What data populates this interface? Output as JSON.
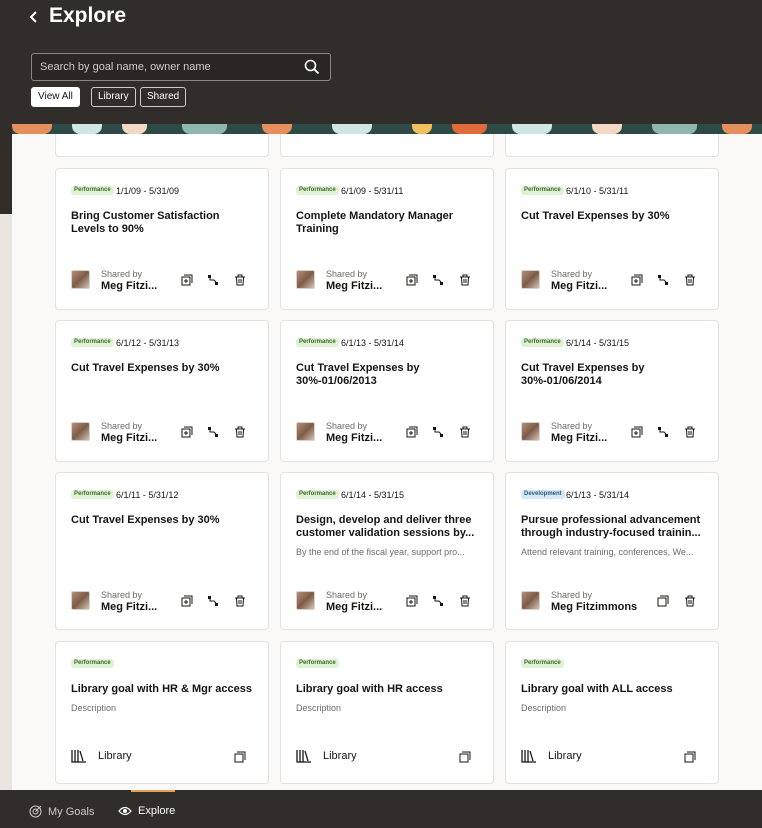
{
  "header": {
    "title": "Explore",
    "search_placeholder": "Search by goal name, owner name",
    "filters": [
      "View All",
      "Library",
      "Shared"
    ]
  },
  "labels": {
    "shared_by": "Shared by",
    "library": "Library"
  },
  "cards": [
    {
      "type": "Performance",
      "dates": "1/1/09 - 5/31/09",
      "title": "Bring Customer Satisfaction Levels to 90%",
      "owner": "Meg Fitzi..."
    },
    {
      "type": "Performance",
      "dates": "6/1/09 - 5/31/11",
      "title": "Complete Mandatory Manager Training",
      "owner": "Meg Fitzi..."
    },
    {
      "type": "Performance",
      "dates": "6/1/10 - 5/31/11",
      "title": "Cut Travel Expenses by 30%",
      "owner": "Meg Fitzi..."
    },
    {
      "type": "Performance",
      "dates": "6/1/12 - 5/31/13",
      "title": "Cut Travel Expenses by 30%",
      "owner": "Meg Fitzi..."
    },
    {
      "type": "Performance",
      "dates": "6/1/13 - 5/31/14",
      "title": "Cut Travel Expenses by 30%-01/06/2013",
      "owner": "Meg Fitzi..."
    },
    {
      "type": "Performance",
      "dates": "6/1/14 - 5/31/15",
      "title": "Cut Travel Expenses by 30%-01/06/2014",
      "owner": "Meg Fitzi..."
    },
    {
      "type": "Performance",
      "dates": "6/1/11 - 5/31/12",
      "title": "Cut Travel Expenses by 30%",
      "owner": "Meg Fitzi..."
    },
    {
      "type": "Performance",
      "dates": "6/1/14 - 5/31/15",
      "title": "Design, develop and deliver three customer validation sessions by...",
      "desc": "By the end of the fiscal year, support pro...",
      "owner": "Meg Fitzi..."
    },
    {
      "type": "Development",
      "dates": "6/1/13 - 5/31/14",
      "title": "Pursue professional advancement through industry-focused trainin...",
      "desc": "Attend relevant training, conferences, We...",
      "owner": "Meg Fitzimmons"
    },
    {
      "type": "Performance",
      "title": "Library goal with HR & Mgr access",
      "desc": "Description"
    },
    {
      "type": "Performance",
      "title": "Library goal with HR access",
      "desc": "Description"
    },
    {
      "type": "Performance",
      "title": "Library goal with ALL access",
      "desc": "Description"
    }
  ],
  "icons": {
    "back": "chevron-left-icon",
    "search": "search-icon",
    "copy": "copy-icon",
    "align": "align-icon",
    "delete": "trash-icon",
    "library": "library-icon",
    "goals": "target-icon",
    "explore": "eye-icon"
  },
  "colors": {
    "header_bg": "#312d2a",
    "performance_badge": "#dff2d5",
    "development_badge": "#d5e8f5",
    "nav_indicator": "#e3a24e"
  },
  "bottom_nav": {
    "my_goals": "My Goals",
    "explore": "Explore"
  }
}
